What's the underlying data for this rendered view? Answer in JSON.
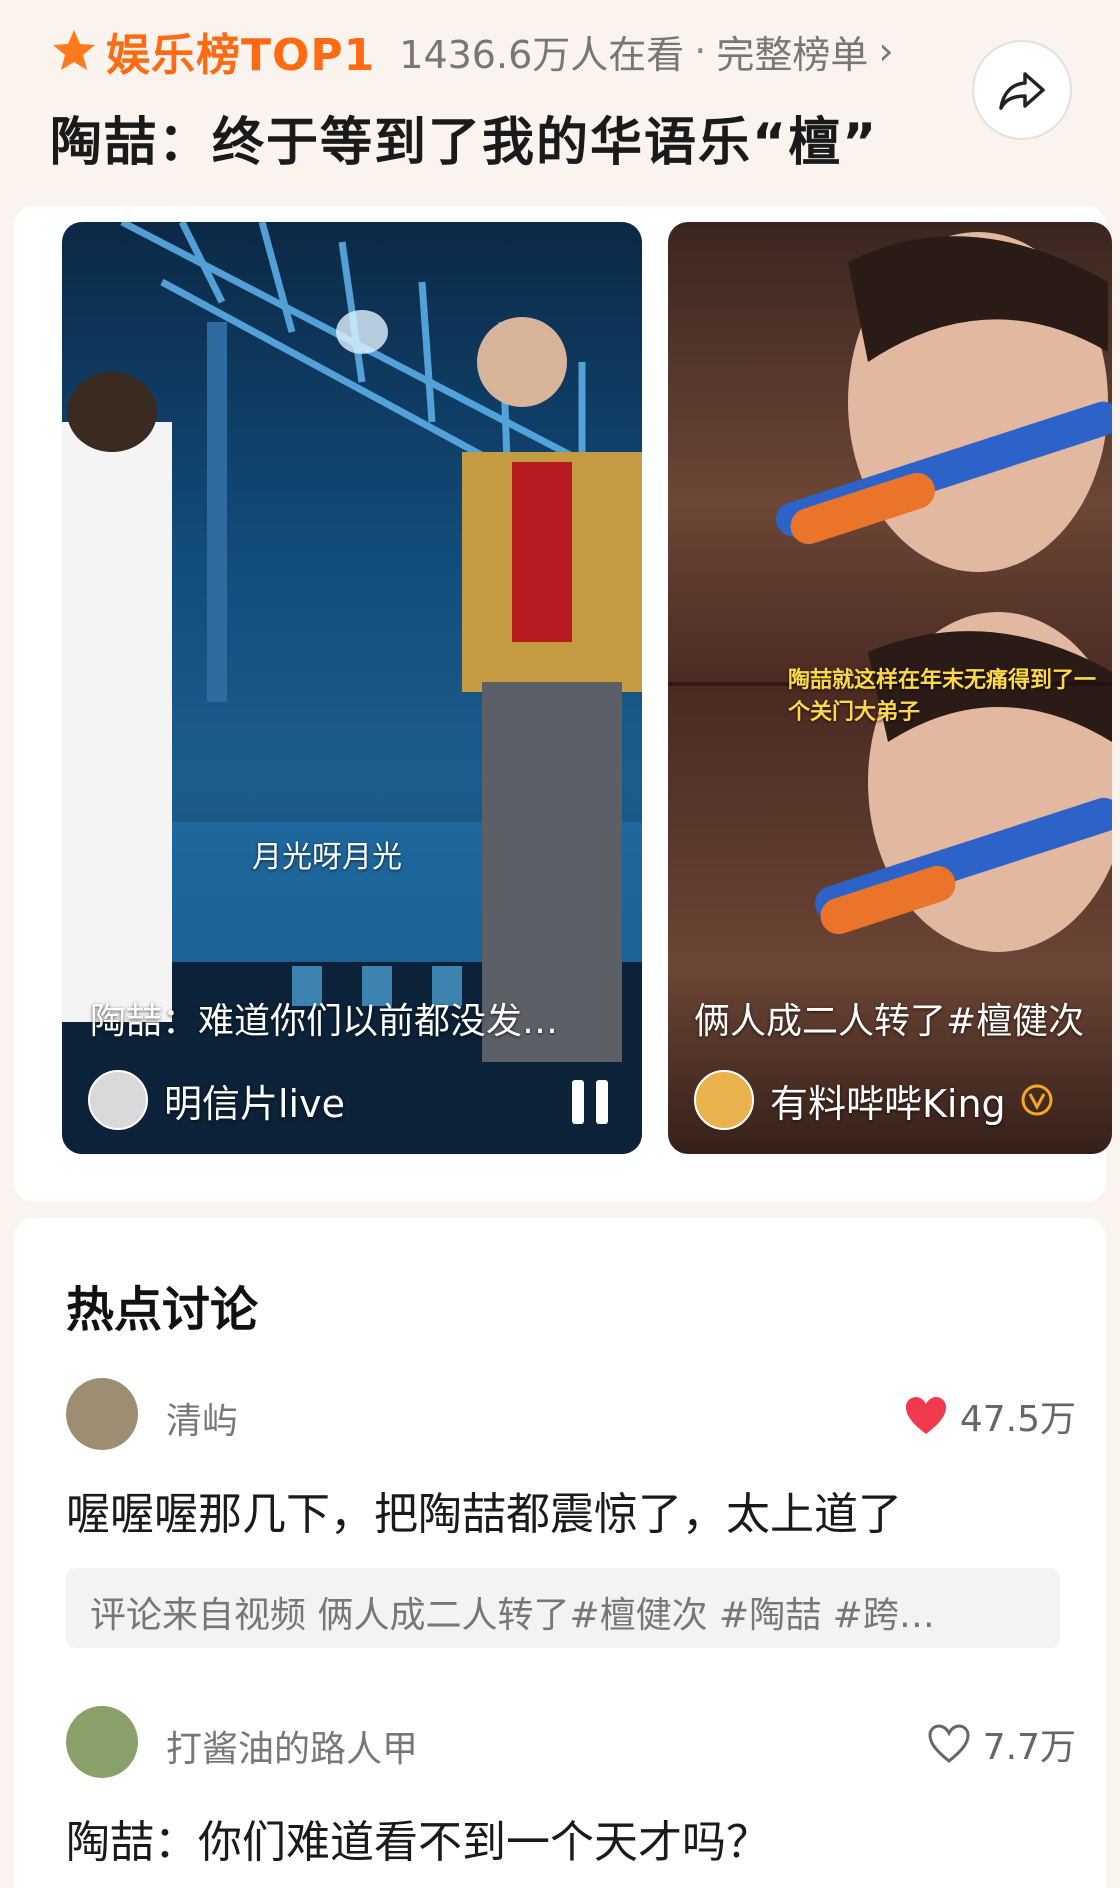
{
  "header": {
    "rank_label": "娱乐榜TOP1",
    "viewers": "1436.6万人在看",
    "separator": "·",
    "full_list": "完整榜单",
    "headline": "陶喆：终于等到了我的华语乐“檀”"
  },
  "videos": [
    {
      "caption_top": "月光呀月光",
      "caption": "陶喆：难道你们以前都没发…",
      "author": "明信片live"
    },
    {
      "overlay": "陶喆就这样在年末无痛得到了一个关门大弟子",
      "caption": "俩人成二人转了#檀健次",
      "author": "有料哔哔King"
    }
  ],
  "discussion": {
    "title": "热点讨论",
    "comments": [
      {
        "user": "清屿",
        "likes": "47.5万",
        "liked": true,
        "text": "喔喔喔那几下，把陶喆都震惊了，太上道了",
        "source": "评论来自视频 俩人成二人转了#檀健次 #陶喆 #跨…"
      },
      {
        "user": "打酱油的路人甲",
        "likes": "7.7万",
        "liked": false,
        "text": "陶喆：你们难道看不到一个天才吗？"
      }
    ]
  },
  "colors": {
    "accent": "#ff6a13",
    "like": "#f23a4f",
    "background": "#fbf3ee"
  }
}
